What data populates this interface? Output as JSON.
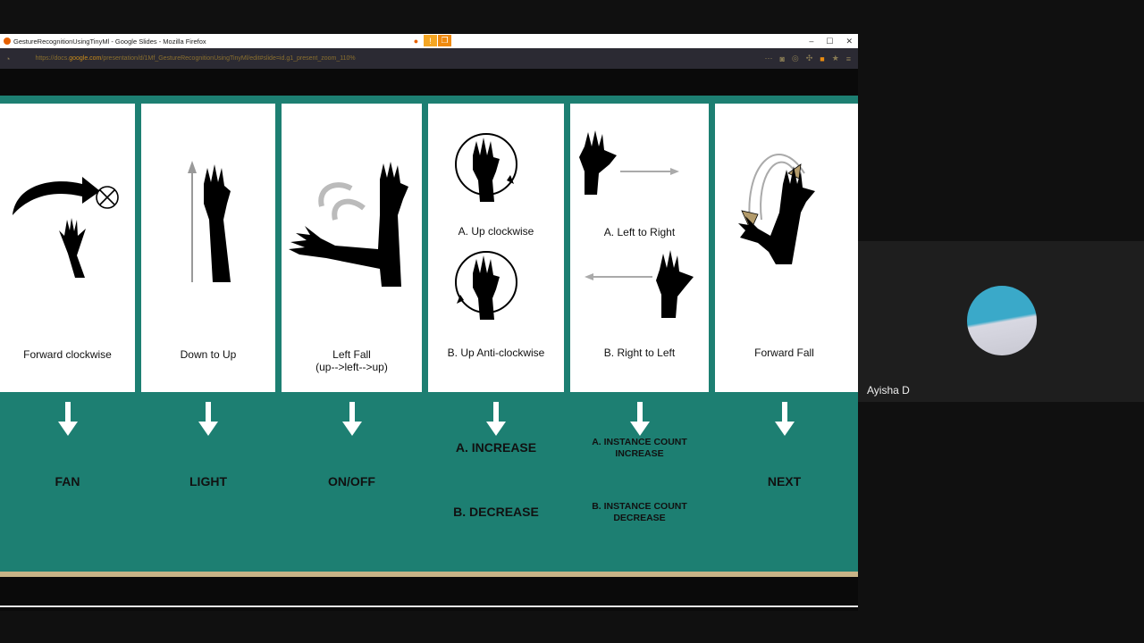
{
  "browser": {
    "title": "GestureRecognitionUsingTinyMl - Google Slides - Mozilla Firefox",
    "url_prefix": "https://docs.",
    "url_host": "google.com",
    "url_rest": "/presentation/d/1Mf_GestureRecognitionUsingTinyMl/edit#slide=id.g1_present_zoom_110%",
    "window_controls": [
      "–",
      "☐",
      "✕"
    ]
  },
  "slide": {
    "columns": [
      {
        "gesture": "Forward clockwise",
        "action": "FAN"
      },
      {
        "gesture": "Down to Up",
        "action": "LIGHT"
      },
      {
        "gesture": "Left Fall",
        "gesture_sub": "(up-->left-->up)",
        "action": "ON/OFF"
      },
      {
        "gesture_a": "A. Up clockwise",
        "gesture_b": "B. Up Anti-clockwise",
        "action_a": "A. INCREASE",
        "action_b": "B. DECREASE"
      },
      {
        "gesture_a": "A. Left to Right",
        "gesture_b": "B. Right to Left",
        "action_a": "A. INSTANCE COUNT INCREASE",
        "action_b": "B. INSTANCE COUNT DECREASE"
      },
      {
        "gesture": "Forward Fall",
        "action": "NEXT"
      }
    ],
    "colors": {
      "teal": "#1d7f72",
      "gold": "#c8b487",
      "hand": "#000000"
    }
  },
  "meet": {
    "participant_name": "Ayisha D"
  }
}
